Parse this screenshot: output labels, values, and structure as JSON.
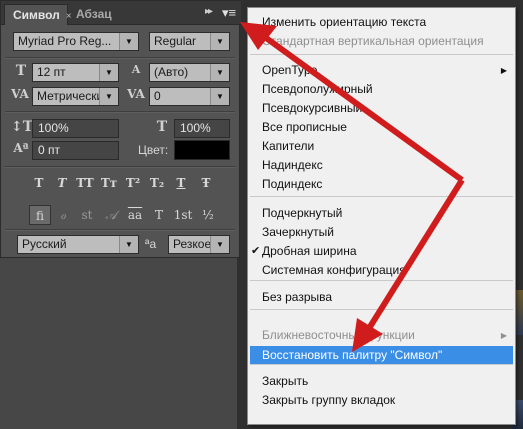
{
  "panel": {
    "tabs": [
      {
        "label": "Символ",
        "close": "×"
      },
      {
        "label": "Абзац",
        "close": ""
      }
    ],
    "collapse_icon": "▸▸",
    "menu_icon": "▾≡",
    "font_family": "Myriad Pro Reg...",
    "font_style": "Regular",
    "font_size": "12 пт",
    "leading": "(Авто)",
    "kerning": "Метрически",
    "tracking": "0",
    "vertical_scale": "100%",
    "horizontal_scale": "100%",
    "baseline_shift": "0 пт",
    "color_label": "Цвет:",
    "color_value": "#000000",
    "type_buttons": [
      "T",
      "T",
      "TT",
      "Tᴛ",
      "T²",
      "T₂",
      "T",
      "Ŧ"
    ],
    "opentype_buttons": [
      "fi",
      "ℴ",
      "st",
      "𝒜",
      "aa",
      "T",
      "1st",
      "½"
    ],
    "language": "Русский",
    "aa_icon": "ªa",
    "antialias": "Резкое"
  },
  "menu": {
    "items": [
      {
        "label": "Изменить ориентацию текста",
        "state": "normal"
      },
      {
        "label": "Стандартная вертикальная ориентация",
        "state": "disabled"
      },
      {
        "label": "OpenType",
        "state": "submenu"
      },
      {
        "label": "Псевдополужирный",
        "state": "normal"
      },
      {
        "label": "Псевдокурсивный",
        "state": "normal"
      },
      {
        "label": "Все прописные",
        "state": "normal"
      },
      {
        "label": "Капители",
        "state": "normal"
      },
      {
        "label": "Надиндекс",
        "state": "normal"
      },
      {
        "label": "Подиндекс",
        "state": "normal"
      },
      {
        "label": "Подчеркнутый",
        "state": "normal"
      },
      {
        "label": "Зачеркнутый",
        "state": "normal"
      },
      {
        "label": "Дробная ширина",
        "state": "checked"
      },
      {
        "label": "Системная конфигурация",
        "state": "normal"
      },
      {
        "label": "Без разрыва",
        "state": "normal"
      },
      {
        "label": "Ближневосточные функции",
        "state": "disabled-submenu"
      },
      {
        "label": "Восстановить палитру \"Символ\"",
        "state": "highlighted"
      },
      {
        "label": "Закрыть",
        "state": "normal"
      },
      {
        "label": "Закрыть группу вкладок",
        "state": "normal"
      }
    ],
    "check_mark": "✔",
    "submenu_arrow": "▶"
  },
  "colors": {
    "arrow": "#d01c1c",
    "highlight": "#3a8ee6",
    "panel": "#535353"
  }
}
